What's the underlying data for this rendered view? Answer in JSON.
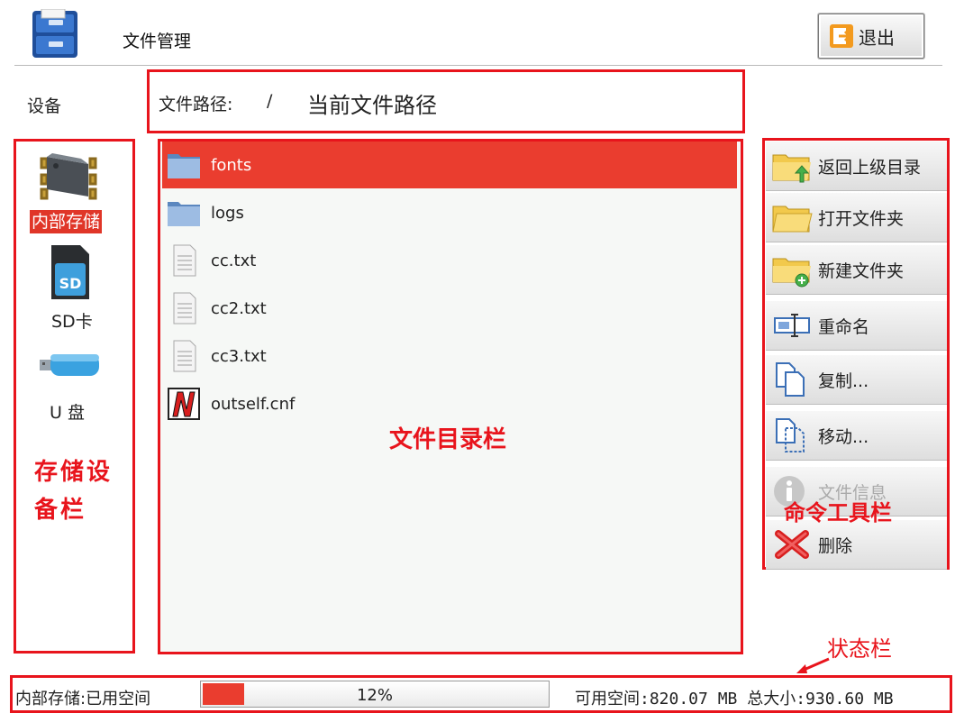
{
  "header": {
    "title": "文件管理",
    "exit_label": "退出"
  },
  "devices": {
    "label": "设备",
    "items": [
      {
        "label": "内部存储",
        "icon": "chip-icon",
        "selected": true
      },
      {
        "label": "SD卡",
        "icon": "sd-card-icon",
        "selected": false
      },
      {
        "label": "U 盘",
        "icon": "usb-drive-icon",
        "selected": false
      }
    ]
  },
  "path": {
    "prefix": "文件路径:",
    "value": "/"
  },
  "files": [
    {
      "name": "fonts",
      "icon": "folder-icon",
      "selected": true
    },
    {
      "name": "logs",
      "icon": "folder-icon",
      "selected": false
    },
    {
      "name": "cc.txt",
      "icon": "text-file-icon",
      "selected": false
    },
    {
      "name": "cc2.txt",
      "icon": "text-file-icon",
      "selected": false
    },
    {
      "name": "cc3.txt",
      "icon": "text-file-icon",
      "selected": false
    },
    {
      "name": "outself.cnf",
      "icon": "cnf-file-icon",
      "selected": false
    }
  ],
  "commands": [
    {
      "label": "返回上级目录",
      "icon": "folder-up-icon",
      "enabled": true
    },
    {
      "label": "打开文件夹",
      "icon": "folder-open-icon",
      "enabled": true
    },
    {
      "label": "新建文件夹",
      "icon": "folder-new-icon",
      "enabled": true
    },
    {
      "label": "重命名",
      "icon": "rename-icon",
      "enabled": true
    },
    {
      "label": "复制...",
      "icon": "copy-icon",
      "enabled": true
    },
    {
      "label": "移动...",
      "icon": "move-icon",
      "enabled": true
    },
    {
      "label": "文件信息",
      "icon": "info-icon",
      "enabled": false
    },
    {
      "label": "删除",
      "icon": "delete-icon",
      "enabled": true
    }
  ],
  "status": {
    "label": "内部存储:已用空间",
    "usage_percent": 12,
    "usage_text": "12%",
    "space_text": "可用空间:820.07 MB 总大小:930.60 MB"
  },
  "annotations": {
    "path": "当前文件路径",
    "device_panel": "存储设备栏",
    "file_panel": "文件目录栏",
    "command_panel": "命令工具栏",
    "status_bar": "状态栏"
  },
  "colors": {
    "accent_red": "#ea3d2f",
    "annotation_red": "#e8141c"
  }
}
